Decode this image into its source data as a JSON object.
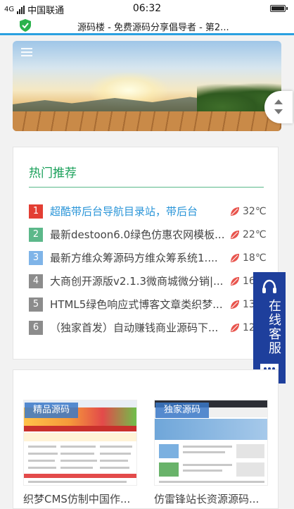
{
  "status_bar": {
    "carrier": "中国联通",
    "time": "06:32",
    "signal_text": "4G"
  },
  "browser": {
    "title": "源码楼 - 免费源码分享倡导者 - 第2..."
  },
  "hot": {
    "heading": "热门推荐",
    "items": [
      {
        "rank": "1",
        "text": "超酷带后台导航目录站，带后台",
        "temp": "32℃",
        "rank_color": "#e33e33"
      },
      {
        "rank": "2",
        "text": "最新destoon6.0绿色仿惠农网模板...",
        "temp": "22℃",
        "rank_color": "#5cb88a"
      },
      {
        "rank": "3",
        "text": "最新方维众筹源码方维众筹系统1....",
        "temp": "18℃",
        "rank_color": "#7fb4e8"
      },
      {
        "rank": "4",
        "text": "大商创开源版v2.1.3微商城微分销|...",
        "temp": "16",
        "rank_color": "#8c8c8c"
      },
      {
        "rank": "5",
        "text": "HTML5绿色响应式博客文章类织梦...",
        "temp": "13",
        "rank_color": "#8c8c8c"
      },
      {
        "rank": "6",
        "text": "（独家首发）自动赚钱商业源码下...",
        "temp": "12",
        "rank_color": "#8c8c8c"
      }
    ]
  },
  "service": {
    "label": "在线客服"
  },
  "cards": [
    {
      "badge": "精品源码",
      "title": "织梦CMS仿制中国作..."
    },
    {
      "badge": "独家源码",
      "title": "仿雷锋站长资源源码..."
    }
  ],
  "colors": {
    "accent_blue": "#2aa0e0",
    "title_green": "#1aa05a",
    "service_blue": "#1e3f9c",
    "leaf_red": "#e8544d"
  }
}
